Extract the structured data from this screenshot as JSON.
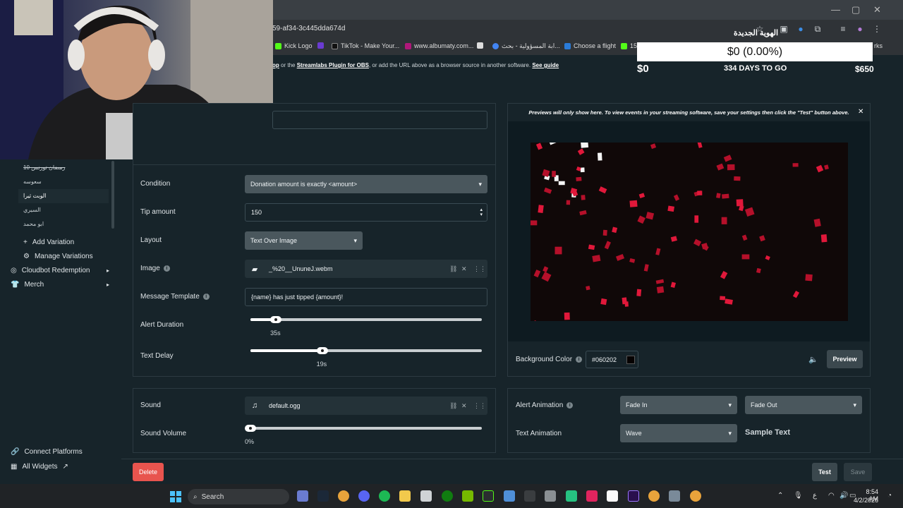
{
  "browser": {
    "url": "59-af34-3c445dda674d",
    "bookmarks": [
      {
        "label": "Kick Logo",
        "color": "#53fc18"
      },
      {
        "label": "TikTok - Make Your...",
        "color": "#111111"
      },
      {
        "label": "www.albumaty.com...",
        "color": "#b0177a"
      },
      {
        "label": "ابة المسؤولية - بحث...",
        "color": "#4285f4"
      },
      {
        "label": "Choose a flight",
        "color": "#2a7bd8"
      },
      {
        "label": "15",
        "color": "#53fc18"
      }
    ],
    "bookmarks_more": "rks",
    "tab_arabic_title": "الهوية الجديدة"
  },
  "info_line": {
    "pre": "op",
    "mid": " or the ",
    "link1": "Streamlabs Plugin for OBS",
    "mid2": ", or add the URL above as a browser source in another software. ",
    "link2": "See guide"
  },
  "goal": {
    "amount": "$0 (0.00%)",
    "start": "$0",
    "days": "334 DAYS TO GO",
    "end": "$650"
  },
  "sidebar": {
    "variations": [
      "رمضان تورنس 10",
      "سعوسه",
      "الوبت ثيرا",
      "السيري",
      "ابو محمد"
    ],
    "add_variation": "Add Variation",
    "manage_variations": "Manage Variations",
    "cloudbot": "Cloudbot Redemption",
    "merch": "Merch",
    "connect": "Connect Platforms",
    "all_widgets": "All Widgets"
  },
  "form": {
    "condition_label": "Condition",
    "condition_value": "Donation amount is exactly <amount>",
    "tip_label": "Tip amount",
    "tip_value": "150",
    "layout_label": "Layout",
    "layout_value": "Text Over Image",
    "image_label": "Image",
    "image_value": "_%20__UnuneJ.webm",
    "template_label": "Message Template",
    "template_value": "{name} has just tipped {amount}!",
    "duration_label": "Alert Duration",
    "duration_value": "35s",
    "duration_fraction": 0.11,
    "delay_label": "Text Delay",
    "delay_value": "19s",
    "delay_fraction": 0.31,
    "sound_label": "Sound",
    "sound_value": "default.ogg",
    "volume_label": "Sound Volume",
    "volume_value": "0%",
    "volume_fraction": 0.0
  },
  "preview": {
    "notice": "Previews will only show here. To view events in your streaming software, save your settings then click the \"Test\" button above.",
    "bg_label": "Background Color",
    "bg_value": "#060202",
    "preview_button": "Preview",
    "alert_anim_label": "Alert Animation",
    "fade_in": "Fade In",
    "fade_out": "Fade Out",
    "text_anim_label": "Text Animation",
    "text_anim_value": "Wave",
    "sample_text": "Sample Text"
  },
  "footer": {
    "delete": "Delete",
    "test": "Test",
    "save": "Save"
  },
  "taskbar": {
    "search": "Search",
    "time": "8:54 AM",
    "date": "4/2/2026",
    "lang": "ع"
  },
  "colors": {
    "accent_red": "#e8544e",
    "panel_bg": "#17242a",
    "select_bg": "#4a575d"
  }
}
